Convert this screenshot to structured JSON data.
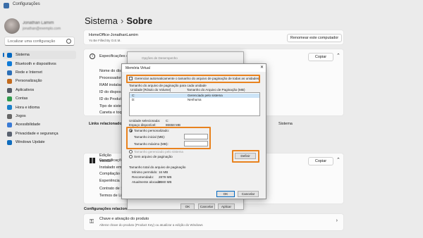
{
  "window": {
    "title": "Configurações"
  },
  "profile": {
    "name": "Jonathan Lamim",
    "email": "jonathan@exemplo.com"
  },
  "search": {
    "placeholder": "Localizar uma configuração"
  },
  "nav": [
    {
      "label": "Sistema",
      "icon": "system-icon",
      "color": "#0067c0",
      "active": true
    },
    {
      "label": "Bluetooth e dispositivos",
      "icon": "bluetooth-icon",
      "color": "#0f7bd8",
      "active": false
    },
    {
      "label": "Rede e Internet",
      "icon": "wifi-icon",
      "color": "#2c6fb7",
      "active": false
    },
    {
      "label": "Personalização",
      "icon": "brush-icon",
      "color": "#c36b1e",
      "active": false
    },
    {
      "label": "Aplicativos",
      "icon": "apps-icon",
      "color": "#555b66",
      "active": false
    },
    {
      "label": "Contas",
      "icon": "person-icon",
      "color": "#2f9a4e",
      "active": false
    },
    {
      "label": "Hora e idioma",
      "icon": "globe-clock-icon",
      "color": "#1a7fc9",
      "active": false
    },
    {
      "label": "Jogos",
      "icon": "gamepad-icon",
      "color": "#666",
      "active": false
    },
    {
      "label": "Acessibilidade",
      "icon": "accessibility-icon",
      "color": "#3a7bd5",
      "active": false
    },
    {
      "label": "Privacidade e segurança",
      "icon": "shield-icon",
      "color": "#5a6270",
      "active": false
    },
    {
      "label": "Windows Update",
      "icon": "update-icon",
      "color": "#0f6cbd",
      "active": false
    }
  ],
  "header": {
    "parent": "Sistema",
    "separator": "›",
    "current": "Sobre"
  },
  "device_card": {
    "name": "HomeOffice-JonathanLamim",
    "model": "Yo Be Filled By O.E.M.",
    "rename_label": "Renomear este computador"
  },
  "device_specs": {
    "title": "Especificações do dispositivo",
    "copy_label": "Copiar",
    "rows": [
      "Nome do dispositivo",
      "Processador",
      "RAM instalada",
      "ID do dispositivo",
      "ID do Produto",
      "Tipo de sistema",
      "Caneta e toque"
    ]
  },
  "related": {
    "title": "Links relacionados",
    "right": "Sistema"
  },
  "windows_specs": {
    "title": "Especificações do Windows",
    "copy_label": "Copiar",
    "rows": [
      "Edição",
      "Versão",
      "Instalado em",
      "Compilação do SO",
      "Experiência",
      "Contrato de Serviços",
      "Termos de Licença"
    ]
  },
  "related_settings": {
    "title": "Configurações relacionadas"
  },
  "product_key": {
    "title": "Chave e ativação do produto",
    "subtitle": "Alterar chave do produto (Product Key) ou atualizar a edição do Windows"
  },
  "perf_dialog": {
    "title": "Opções de Desempenho",
    "ok": "OK",
    "cancel": "Cancelar",
    "apply": "Aplicar"
  },
  "vm_dialog": {
    "title": "Memória Virtual",
    "close": "✕",
    "auto_manage": "Gerenciar automaticamente o tamanho do arquivo de paginação de todas as unidades",
    "paging_group": "Tamanho do arquivo de paginação para cada unidade",
    "col_drive": "Unidade [Rótulo do Volume]",
    "col_size": "Tamanho do Arquivo de Paginação (MB)",
    "drives": [
      {
        "drive": "C:",
        "size": "Gerenciado pelo sistema",
        "selected": true
      },
      {
        "drive": "D:",
        "size": "Nenhuma",
        "selected": false
      }
    ],
    "selected_drive_label": "Unidade selecionada:",
    "selected_drive_value": "C:",
    "free_space_label": "Espaço disponível:",
    "free_space_value": "86658 MB",
    "custom_size": "Tamanho personalizado:",
    "initial_size": "Tamanho inicial (MB):",
    "max_size": "Tamanho máximo (MB):",
    "system_managed": "Tamanho gerenciado pelo sistema",
    "no_paging": "Sem arquivo de paginação",
    "set_button": "Definir",
    "total_group": "Tamanho total do arquivo de paginação",
    "min_label": "Mínimo permitido:",
    "min_value": "16 MB",
    "rec_label": "Recomendado:",
    "rec_value": "2879 MB",
    "cur_label": "Atualmente alocado:",
    "cur_value": "2560 MB",
    "ok": "OK",
    "cancel": "Cancelar"
  },
  "colors": {
    "accent": "#0067c0",
    "highlight": "#e8821e"
  }
}
